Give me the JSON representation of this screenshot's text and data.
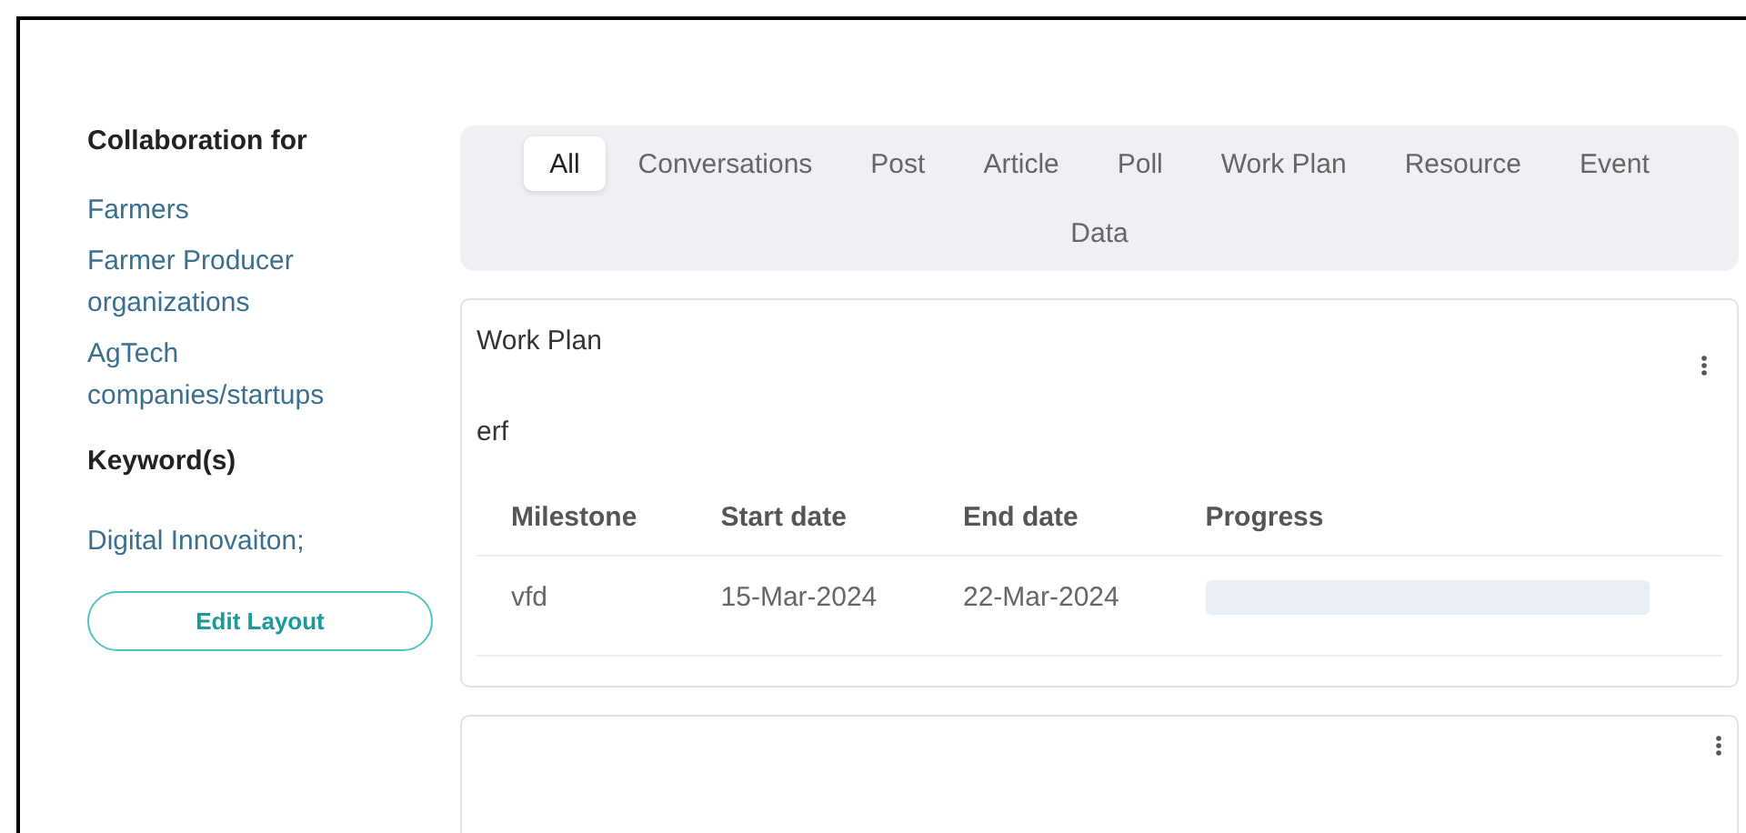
{
  "sidebar": {
    "collaboration_heading": "Collaboration for",
    "collaboration_items": [
      "Farmers",
      "Farmer Producer organizations",
      "AgTech companies/startups"
    ],
    "keywords_heading": "Keyword(s)",
    "keywords": [
      "Digital Innovaiton;"
    ],
    "edit_button": "Edit Layout"
  },
  "tabs": [
    {
      "label": "All",
      "selected": true
    },
    {
      "label": "Conversations",
      "selected": false
    },
    {
      "label": "Post",
      "selected": false
    },
    {
      "label": "Article",
      "selected": false
    },
    {
      "label": "Poll",
      "selected": false
    },
    {
      "label": "Work Plan",
      "selected": false
    },
    {
      "label": "Resource",
      "selected": false
    },
    {
      "label": "Event",
      "selected": false
    },
    {
      "label": "Data",
      "selected": false
    }
  ],
  "cards": [
    {
      "title": "Work Plan",
      "description": "erf",
      "table": {
        "columns": [
          "Milestone",
          "Start date",
          "End date",
          "Progress"
        ],
        "rows": [
          {
            "milestone": "vfd",
            "start_date": "15-Mar-2024",
            "end_date": "22-Mar-2024",
            "level": 0
          }
        ]
      }
    }
  ]
}
